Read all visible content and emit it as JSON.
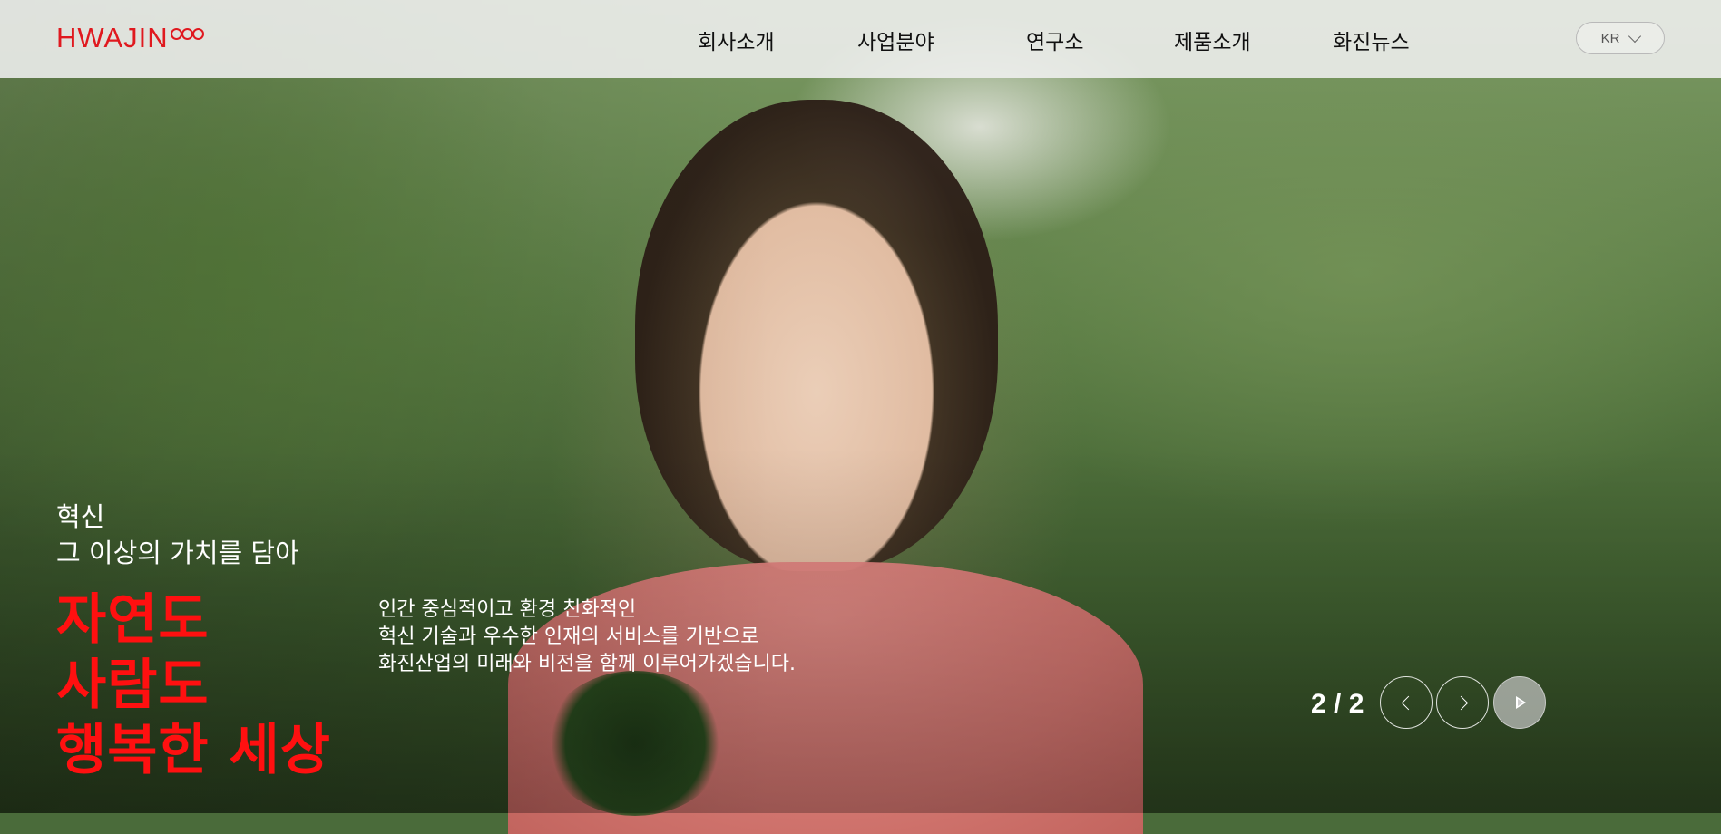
{
  "brand": {
    "logo_text": "HWAJIN",
    "accent": "#e0191f"
  },
  "nav": {
    "items": [
      {
        "label": "회사소개"
      },
      {
        "label": "사업분야"
      },
      {
        "label": "연구소"
      },
      {
        "label": "제품소개"
      },
      {
        "label": "화진뉴스"
      }
    ]
  },
  "language": {
    "selected": "KR",
    "icon": "chevron-down-icon"
  },
  "hero": {
    "tagline_line1": "혁신",
    "tagline_line2": "그 이상의 가치를 담아",
    "headline_line1": "자연도",
    "headline_line2": "사람도",
    "headline_line3": "행복한 세상",
    "headline_color": "#ff1010",
    "desc_line1": "인간 중심적이고 환경 친화적인",
    "desc_line2": "혁신 기술과 우수한 인재의 서비스를 기반으로",
    "desc_line3": "화진산업의 미래와 비전을 함께 이루어가겠습니다."
  },
  "slider": {
    "counter": "2 / 2",
    "prev_icon": "chevron-left-icon",
    "next_icon": "chevron-right-icon",
    "play_icon": "play-icon"
  }
}
